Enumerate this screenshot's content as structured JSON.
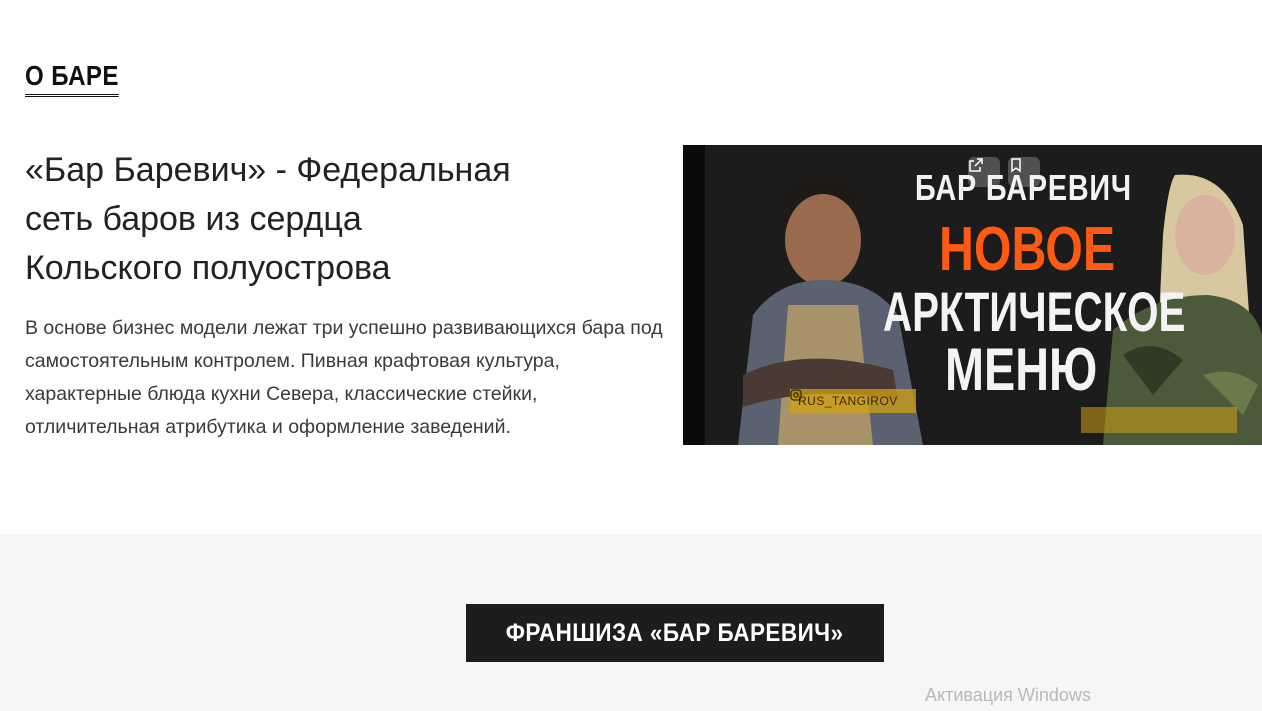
{
  "about": {
    "heading": "О БАРЕ",
    "headline": "«Бар Баревич» - Федеральная\nсеть баров из сердца\nКольского полуострова",
    "body": "В основе бизнес модели лежат три успешно развивающихся бара под самостоятельным контролем. Пивная крафтовая культура, характерные блюда кухни Севера, классические стейки, отличительная атрибутика и оформление заведений."
  },
  "video": {
    "title": "БАР БАРЕВИЧ",
    "line1": "НОВОЕ",
    "line2": "АРКТИЧЕСКОЕ",
    "line3": "МЕНЮ",
    "handle": "RUS_TANGIROV",
    "icons": [
      "open-external-icon",
      "bookmark-icon",
      "instagram-icon"
    ],
    "colors": {
      "accent": "#ff5a14",
      "badge": "#d2a014"
    }
  },
  "franchise": {
    "button_label": "ФРАНШИЗА «БАР БАРЕВИЧ»"
  },
  "system": {
    "watermark": "Активация Windows"
  }
}
